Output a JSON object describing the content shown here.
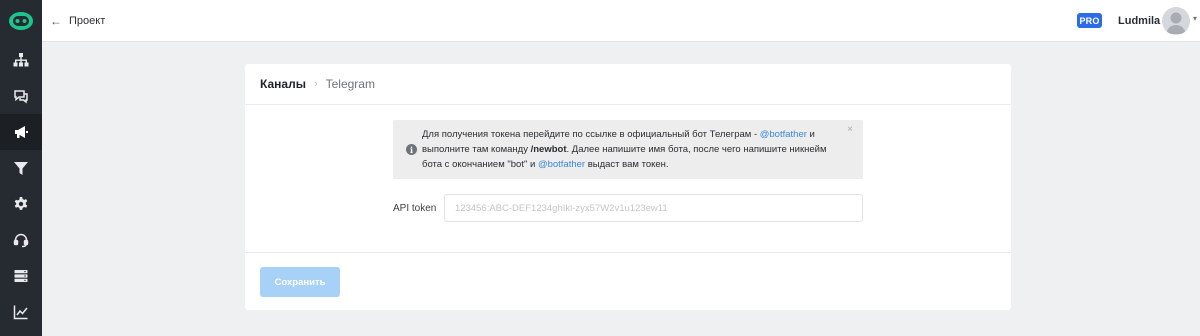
{
  "header": {
    "back_label": "Проект",
    "pro_badge": "PRO",
    "username": "Ludmila"
  },
  "sidebar": {
    "items": [
      {
        "icon": "sitemap-icon",
        "active": false
      },
      {
        "icon": "chat-icon",
        "active": false
      },
      {
        "icon": "megaphone-icon",
        "active": true
      },
      {
        "icon": "filter-icon",
        "active": false
      },
      {
        "icon": "gear-icon",
        "active": false
      },
      {
        "icon": "headset-icon",
        "active": false
      },
      {
        "icon": "server-icon",
        "active": false
      },
      {
        "icon": "chart-line-icon",
        "active": false
      }
    ]
  },
  "card": {
    "breadcrumb_main": "Каналы",
    "breadcrumb_separator": "›",
    "breadcrumb_sub": "Telegram",
    "info": {
      "text_1": "Для получения токена перейдите по ссылке в официальный бот Телеграм - ",
      "link_1": "@botfather",
      "text_2": " и выполните там команду ",
      "command": "/newbot",
      "text_3": ". Далее напишите имя бота, после чего напишите никнейм бота с окончанием \"bot\" и ",
      "link_2": "@botfather",
      "text_4": " выдаст вам токен.",
      "close": "×"
    },
    "api_token_label": "API token",
    "api_token_placeholder": "123456:ABC-DEF1234ghIkl-zyx57W2v1u123ew11",
    "save_label": "Сохранить"
  },
  "colors": {
    "sidebar_bg": "#262b31",
    "logo_accent": "#1fc38c",
    "pro_badge": "#2e6be6",
    "link": "#3a87d6",
    "save_button_disabled": "#a7d1f6"
  }
}
